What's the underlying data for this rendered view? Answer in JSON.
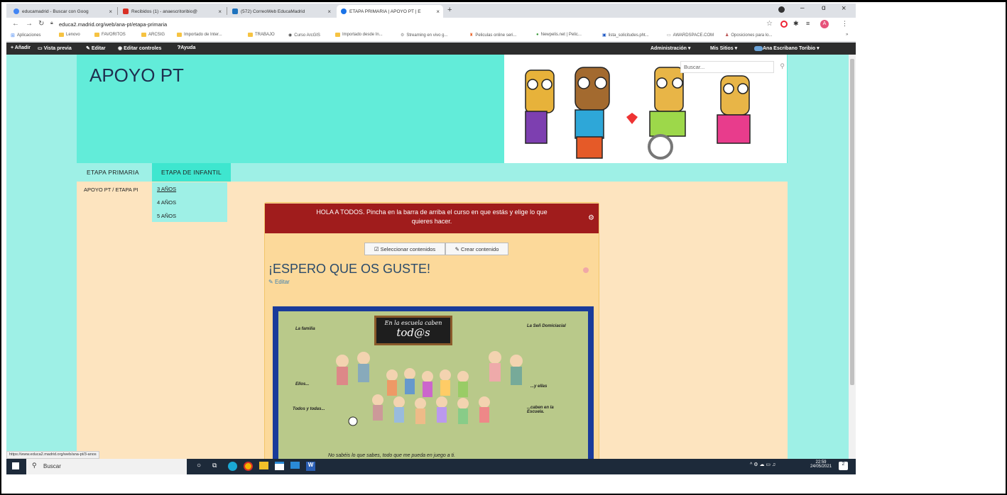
{
  "browser": {
    "tabs": [
      {
        "title": "educamadrid - Buscar con Goog",
        "icon": "google-icon",
        "color": "#4285f4"
      },
      {
        "title": "Recibidos (1) - anaescritoribio@",
        "icon": "gmail-icon",
        "color": "#d93025"
      },
      {
        "title": "(572) CorreoWeb EducaMadrid",
        "icon": "mail-icon",
        "color": "#1e73be"
      },
      {
        "title": "ETAPA PRIMARIA | APOYO PT | E",
        "icon": "globe-icon",
        "color": "#1a73e8"
      }
    ],
    "new_tab": "+",
    "url": "educa2.madrid.org/web/ana-pt/etapa-primaria",
    "bookmarks": [
      "Aplicaciones",
      "Lenovo",
      "FAVORITOS",
      "ARCSIG",
      "Importado de Inter...",
      "TRABAJO",
      "Curso ArcGIS",
      "Importado desde In...",
      "Streaming en vivo g...",
      "Peliculas online seri...",
      "Newpelis.net | Pelic...",
      "lista_solicitudes.pht...",
      "AWARDSPACE.COM",
      "Oposiciones para lo..."
    ],
    "bookmarks_more": "»",
    "window_controls": {
      "minimize": "–",
      "maximize": "ɑ",
      "close": "×"
    },
    "status_url": "https://www.educa2.madrid.org/web/ana-pt/3-anos"
  },
  "adminbar": {
    "left": [
      "+ Añadir",
      "Vista previa",
      "Editar",
      "Editar controles",
      "Ayuda"
    ],
    "administracion": "Administración",
    "mis_sitios": "Mis Sitios",
    "user": "Ana Escribano Toribio"
  },
  "site": {
    "title": "APOYO PT",
    "search_placeholder": "Buscar...",
    "nav": [
      "ETAPA PRIMARIA",
      "ETAPA DE INFANTIL"
    ],
    "breadcrumb": "APOYO PT / ETAPA PI",
    "dropdown": [
      "3 AÑOS",
      "4 AÑOS",
      "5 AÑOS"
    ],
    "alert_line1": "HOLA A TODOS. Pincha en la barra de arriba el curso en que estás y elige lo que",
    "alert_line2": "quieres hacer.",
    "btn_select": "Seleccionar contenidos",
    "btn_create": "Crear contenido",
    "heading": "¡ESPERO QUE OS GUSTE!",
    "edit_link": "Editar",
    "image_texts": {
      "board": "En la escuela caben",
      "board2": "tod@s",
      "tl": "La familia",
      "tr": "La Señ Domiciacial",
      "ml": "Ellos...",
      "mr": "...y ellas",
      "bl": "Todos y todas...",
      "br": "...caben en la Escuela.",
      "bottom": "No sabéis lo que sabes, todo que me pueda en juego a ti."
    }
  },
  "taskbar": {
    "search": "Buscar",
    "time": "22:59",
    "date": "24/05/2021",
    "notif": "2"
  },
  "colors": {
    "banner": "#62ecd9",
    "alert": "#a01c1c",
    "page_bg": "#fde4bf"
  }
}
